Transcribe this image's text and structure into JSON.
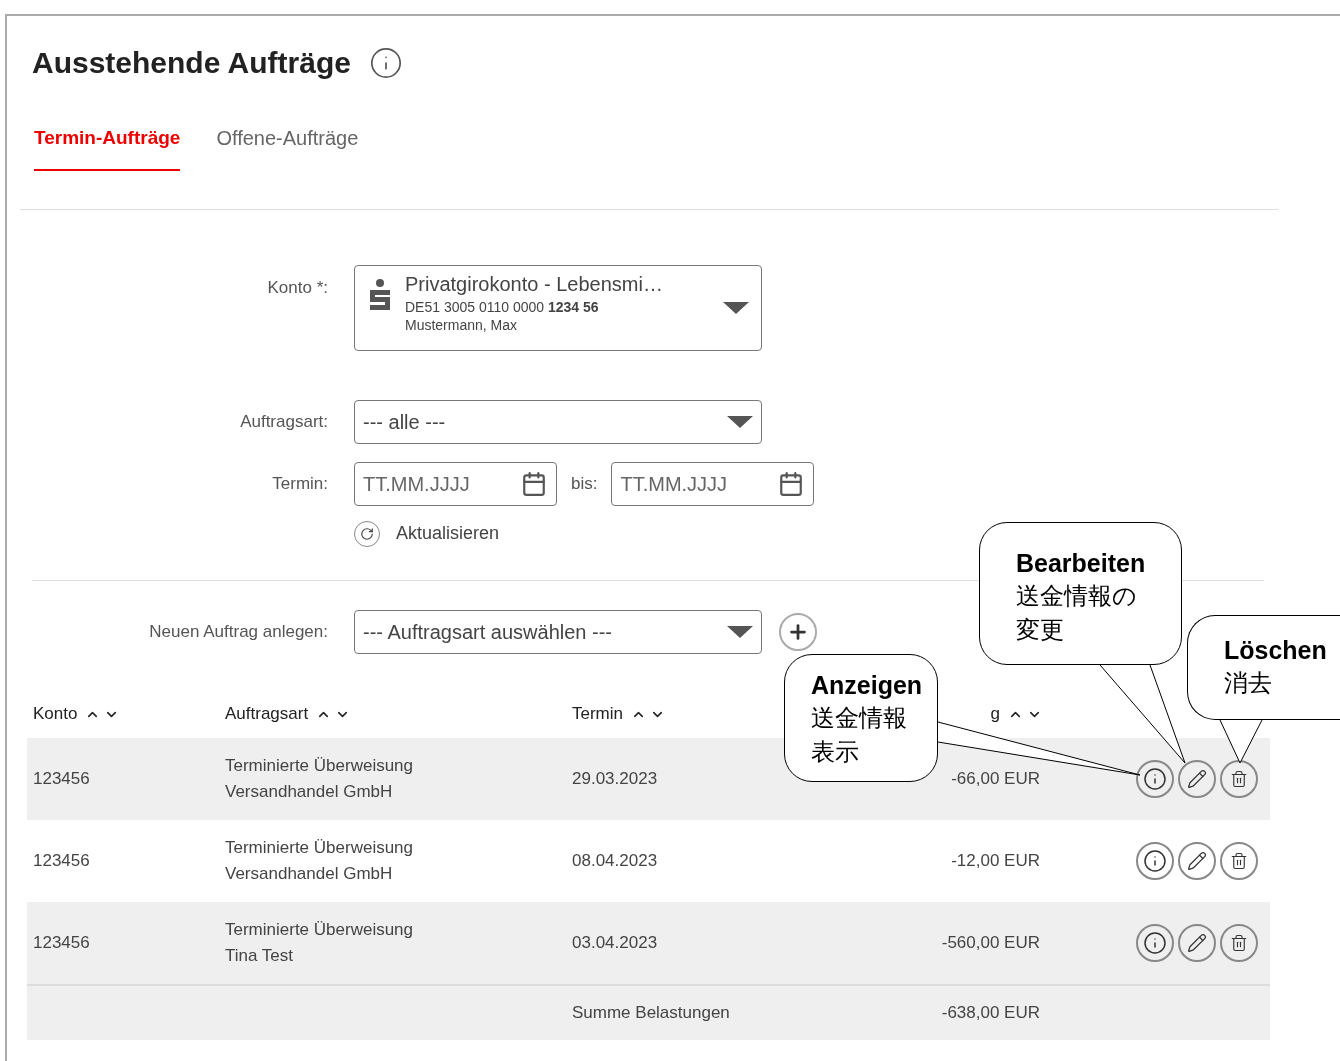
{
  "title": "Ausstehende Aufträge",
  "tabs": [
    {
      "label": "Termin-Aufträge",
      "selected": true
    },
    {
      "label": "Offene-Aufträge",
      "selected": false
    }
  ],
  "filters": {
    "konto": {
      "label": "Konto *:",
      "name": "Privatgirokonto - Lebensmi…",
      "iban": "DE51 3005 0110 0000 **1234 56**",
      "holder": "Mustermann, Max"
    },
    "auftragsart": {
      "label": "Auftragsart:",
      "value": "--- alle ---"
    },
    "termin": {
      "label": "Termin:",
      "from": {
        "placeholder": "TT.MM.JJJJ"
      },
      "to": {
        "label": "bis:",
        "placeholder": "TT.MM.JJJJ"
      }
    },
    "refresh": "Aktualisieren"
  },
  "new_order": {
    "label": "Neuen Auftrag anlegen:",
    "value": "--- Auftragsart auswählen ---"
  },
  "table": {
    "columns": [
      {
        "label": "Konto"
      },
      {
        "label": "Auftragsart"
      },
      {
        "label": "Termin"
      },
      {
        "label": "g"
      }
    ],
    "rows": [
      {
        "konto": "123456",
        "type": "Terminierte Überweisung",
        "recipient": "Versandhandel GmbH",
        "date": "29.03.2023",
        "amount": "-66,00 EUR"
      },
      {
        "konto": "123456",
        "type": "Terminierte Überweisung",
        "recipient": "Versandhandel GmbH",
        "date": "08.04.2023",
        "amount": "-12,00 EUR"
      },
      {
        "konto": "123456",
        "type": "Terminierte Überweisung",
        "recipient": "Tina Test",
        "date": "03.04.2023",
        "amount": "-560,00 EUR"
      }
    ],
    "total": {
      "label": "Summe Belastungen",
      "amount": "-638,00 EUR"
    }
  },
  "callouts": [
    {
      "title": "Anzeigen",
      "lines": [
        "送金情報",
        "表示"
      ]
    },
    {
      "title": "Bearbeiten",
      "lines": [
        "送金情報の",
        "変更"
      ]
    },
    {
      "title": "Löschen",
      "lines": [
        "消去"
      ]
    }
  ]
}
